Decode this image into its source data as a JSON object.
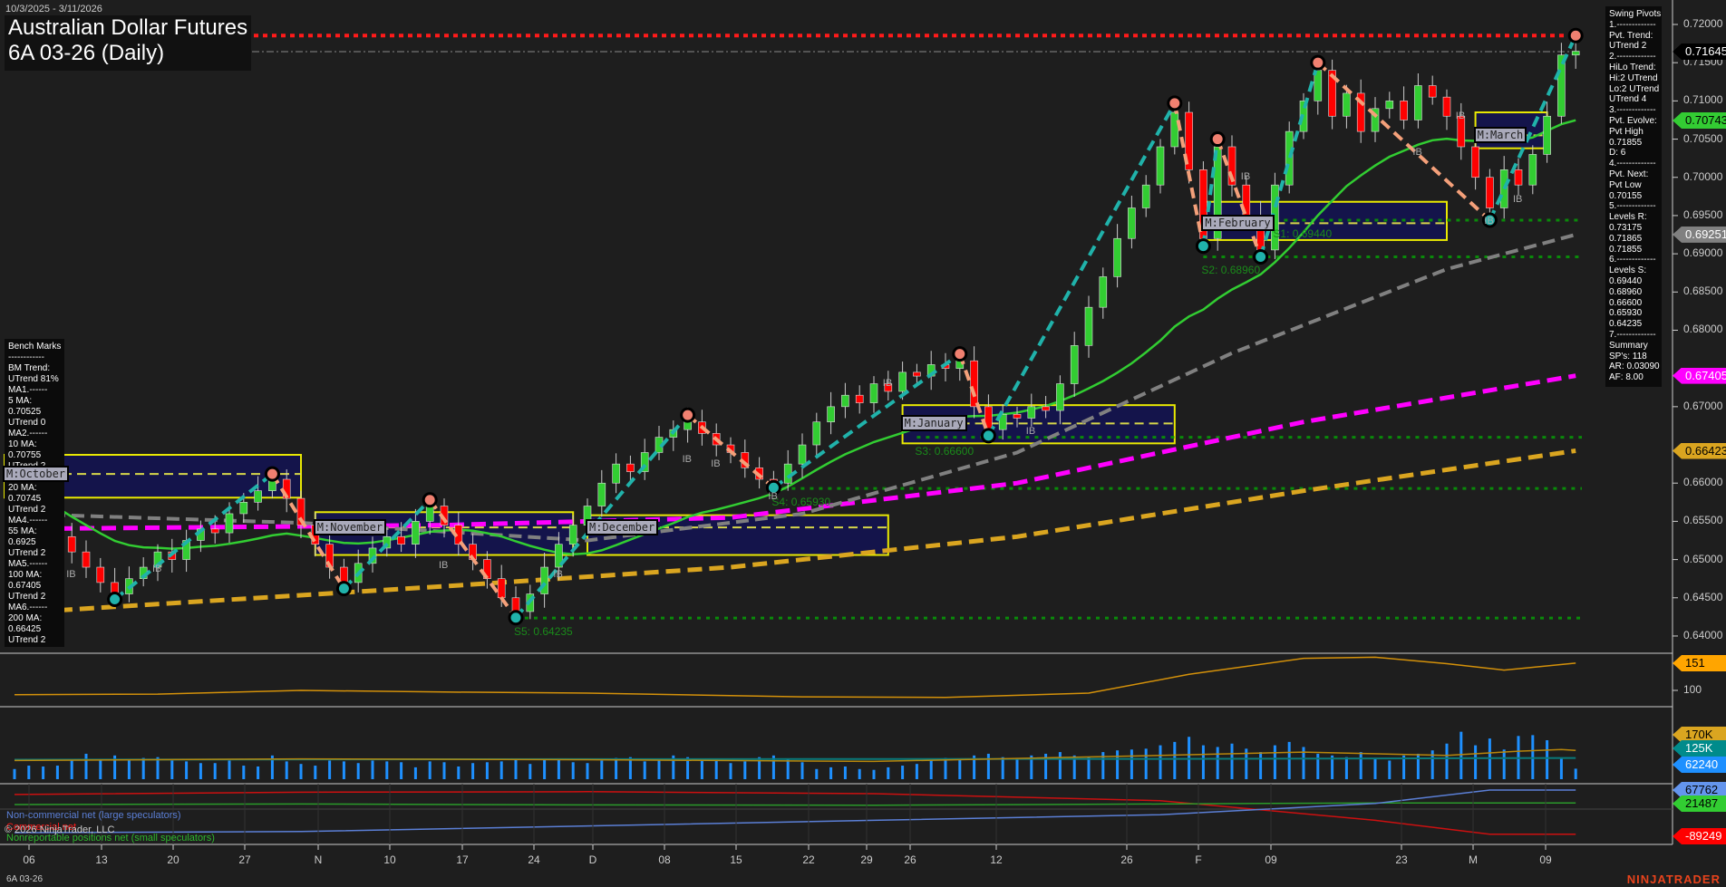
{
  "header": {
    "date_range": "10/3/2025 - 3/11/2026",
    "title": "Australian Dollar Futures",
    "subtitle": "6A 03-26 (Daily)"
  },
  "bench_marks": [
    "Bench Marks",
    "------------",
    "BM Trend:",
    "UTrend 81%",
    "MA1.------",
    "5 MA:",
    "0.70525",
    "UTrend 0",
    "MA2.------",
    "10 MA:",
    "0.70755",
    "UTrend 2",
    "MA3.------",
    "20 MA:",
    "0.70745",
    "UTrend 2",
    "MA4.------",
    "55 MA:",
    "0.6925",
    "UTrend 2",
    "MA5.------",
    "100 MA:",
    "0.67405",
    "UTrend 2",
    "MA6.------",
    "200 MA:",
    "0.66425",
    "UTrend 2"
  ],
  "swing_pivots": [
    "Swing Pivots",
    "1.-------------",
    "Pvt. Trend:",
    "UTrend 2",
    "2.-------------",
    "HiLo Trend:",
    "Hi:2 UTrend",
    "Lo:2 UTrend",
    "UTrend 4",
    "3.-------------",
    "Pvt. Evolve:",
    "Pvt High",
    "0.71855",
    "D: 6",
    "4.-------------",
    "Pvt. Next:",
    "Pvt Low",
    "0.70155",
    "5.-------------",
    "Levels R:",
    "0.73175",
    "0.71865",
    "0.71855",
    "6.-------------",
    "Levels S:",
    "0.69440",
    "0.68960",
    "0.66600",
    "0.65930",
    "0.64235",
    "7.-------------",
    "Summary",
    "SP's: 118",
    "AR: 0.03090",
    "AF: 8.00"
  ],
  "price_axis": [
    "0.72000",
    "0.71500",
    "0.71000",
    "0.70500",
    "0.70000",
    "0.69500",
    "0.69000",
    "0.68500",
    "0.68000",
    "0.67000",
    "0.66000",
    "0.65500",
    "0.65000",
    "0.64500",
    "0.64000"
  ],
  "price_tags": [
    {
      "label": "0.71645",
      "value": 0.71645,
      "bg": "#000000",
      "fg": "#ffffff"
    },
    {
      "label": "0.70743",
      "value": 0.70743,
      "bg": "#33cc33",
      "fg": "#000000"
    },
    {
      "label": "0.69251",
      "value": 0.69251,
      "bg": "#808080",
      "fg": "#ffffff"
    },
    {
      "label": "0.67405",
      "value": 0.67405,
      "bg": "#ff00ff",
      "fg": "#ffffff"
    },
    {
      "label": "0.66423",
      "value": 0.66423,
      "bg": "#daa520",
      "fg": "#000000"
    }
  ],
  "sub_tags": [
    {
      "label": "151",
      "bg": "#ffa500",
      "fg": "#000000"
    },
    {
      "label": "170K",
      "bg": "#daa520",
      "fg": "#000000"
    },
    {
      "label": "125K",
      "bg": "#008b8b",
      "fg": "#ffffff"
    },
    {
      "label": "62240",
      "bg": "#1e90ff",
      "fg": "#ffffff"
    },
    {
      "label": "67762",
      "bg": "#6495ed",
      "fg": "#000000"
    },
    {
      "label": "21487",
      "bg": "#32cd32",
      "fg": "#000000"
    },
    {
      "label": "-89249",
      "bg": "#ff0000",
      "fg": "#ffffff"
    }
  ],
  "sub_axis": {
    "osc_tick": "100"
  },
  "x_axis": [
    "06",
    "13",
    "20",
    "27",
    "N",
    "10",
    "17",
    "24",
    "D",
    "08",
    "15",
    "22",
    "29",
    "26",
    "12",
    "26",
    "F",
    "09",
    "23",
    "M",
    "09"
  ],
  "month_boxes": [
    {
      "label": "M:October",
      "from": -1,
      "to": 20,
      "top": 0.6637,
      "bottom": 0.6581,
      "mid": 0.6612
    },
    {
      "label": "M:November",
      "from": 21,
      "to": 39,
      "top": 0.6562,
      "bottom": 0.6506,
      "mid": 0.6542
    },
    {
      "label": "M:December",
      "from": 40,
      "to": 61,
      "top": 0.6558,
      "bottom": 0.6506,
      "mid": 0.6542
    },
    {
      "label": "M:January",
      "from": 62,
      "to": 81,
      "top": 0.6702,
      "bottom": 0.6652,
      "mid": 0.6678
    },
    {
      "label": "M:February",
      "from": 83,
      "to": 100,
      "top": 0.6968,
      "bottom": 0.6918,
      "mid": 0.694
    },
    {
      "label": "M:March",
      "from": 102,
      "to": 107,
      "top": 0.7085,
      "bottom": 0.7038,
      "mid": 0.7055
    }
  ],
  "levels": [
    {
      "label": "S1: 0.69440",
      "value": 0.6944,
      "from": 88
    },
    {
      "label": "S2: 0.68960",
      "value": 0.6896,
      "from": 83
    },
    {
      "label": "S3: 0.66600",
      "value": 0.666,
      "from": 63
    },
    {
      "label": "S4: 0.65930",
      "value": 0.6593,
      "from": 53
    },
    {
      "label": "S5: 0.64235",
      "value": 0.64235,
      "from": 35
    }
  ],
  "resistance_line": 0.71855,
  "last_price_line": 0.71645,
  "ib_labels": [
    [
      4,
      0.6488
    ],
    [
      10,
      0.6495
    ],
    [
      30,
      0.6499
    ],
    [
      38,
      0.6488
    ],
    [
      47,
      0.6638
    ],
    [
      49,
      0.6632
    ],
    [
      53,
      0.659
    ],
    [
      61,
      0.6738
    ],
    [
      71,
      0.6675
    ],
    [
      86,
      0.7008
    ],
    [
      98,
      0.704
    ],
    [
      101,
      0.7087
    ],
    [
      105,
      0.6978
    ],
    [
      103,
      0.695
    ]
  ],
  "legend": {
    "noncommercial": "Non-commercial net (large speculators)",
    "commercial": "Commercial net",
    "nonreportable": "Nonreportable positions net (small speculators)",
    "copyright": "© 2026 NinjaTrader, LLC"
  },
  "footer": {
    "instrument": "6A 03-26",
    "logo": "NINJATRADER"
  },
  "colors": {
    "up": "#32cd32",
    "down": "#ff0000",
    "ma20": "#32cd32",
    "ma55": "#808080",
    "ma100": "#ff00ff",
    "ma200": "#daa520",
    "swing_up": "#20b2aa",
    "swing_down": "#f4a07a"
  },
  "chart_data": {
    "type": "candlestick",
    "title": "Australian Dollar Futures 6A 03-26 (Daily)",
    "ylim": [
      0.6375,
      0.7225
    ],
    "closes": [
      0.66,
      0.658,
      0.656,
      0.653,
      0.651,
      0.649,
      0.647,
      0.6455,
      0.6475,
      0.649,
      0.651,
      0.65,
      0.6525,
      0.654,
      0.6535,
      0.656,
      0.6575,
      0.659,
      0.6605,
      0.658,
      0.6545,
      0.652,
      0.649,
      0.647,
      0.6495,
      0.6515,
      0.653,
      0.652,
      0.655,
      0.657,
      0.6545,
      0.652,
      0.65,
      0.6475,
      0.645,
      0.6432,
      0.6455,
      0.649,
      0.652,
      0.6545,
      0.657,
      0.66,
      0.6625,
      0.6615,
      0.664,
      0.666,
      0.667,
      0.668,
      0.6665,
      0.665,
      0.664,
      0.662,
      0.6605,
      0.66,
      0.6625,
      0.665,
      0.668,
      0.67,
      0.6715,
      0.6705,
      0.673,
      0.672,
      0.6745,
      0.674,
      0.6755,
      0.675,
      0.676,
      0.67,
      0.667,
      0.669,
      0.6685,
      0.67,
      0.6695,
      0.673,
      0.678,
      0.683,
      0.687,
      0.692,
      0.696,
      0.699,
      0.704,
      0.7085,
      0.701,
      0.692,
      0.704,
      0.699,
      0.695,
      0.6905,
      0.699,
      0.706,
      0.71,
      0.714,
      0.708,
      0.711,
      0.706,
      0.709,
      0.71,
      0.7075,
      0.712,
      0.7105,
      0.708,
      0.704,
      0.7,
      0.696,
      0.701,
      0.699,
      0.703,
      0.708,
      0.716,
      0.7165
    ],
    "pivots": [
      [
        7,
        0.6448,
        "L"
      ],
      [
        18,
        0.6612,
        "H"
      ],
      [
        23,
        0.6462,
        "L"
      ],
      [
        29,
        0.6578,
        "H"
      ],
      [
        35,
        0.6424,
        "L"
      ],
      [
        47,
        0.6689,
        "H"
      ],
      [
        53,
        0.6594,
        "L"
      ],
      [
        66,
        0.6769,
        "H"
      ],
      [
        68,
        0.6662,
        "L"
      ],
      [
        81,
        0.7097,
        "H"
      ],
      [
        83,
        0.691,
        "L"
      ],
      [
        84,
        0.705,
        "H"
      ],
      [
        87,
        0.6896,
        "L"
      ],
      [
        91,
        0.715,
        "H"
      ],
      [
        103,
        0.6944,
        "L"
      ],
      [
        109,
        0.71855,
        "H"
      ]
    ],
    "ma55": [
      [
        0,
        0.656
      ],
      [
        20,
        0.6548
      ],
      [
        40,
        0.6525
      ],
      [
        55,
        0.656
      ],
      [
        70,
        0.664
      ],
      [
        85,
        0.677
      ],
      [
        100,
        0.688
      ],
      [
        109,
        0.6925
      ]
    ],
    "ma100": [
      [
        0,
        0.654
      ],
      [
        30,
        0.6545
      ],
      [
        50,
        0.6555
      ],
      [
        70,
        0.66
      ],
      [
        90,
        0.668
      ],
      [
        109,
        0.67405
      ]
    ],
    "ma200": [
      [
        0,
        0.643
      ],
      [
        30,
        0.6465
      ],
      [
        50,
        0.649
      ],
      [
        70,
        0.653
      ],
      [
        90,
        0.659
      ],
      [
        109,
        0.66423
      ]
    ],
    "oscillator": [
      [
        0,
        92
      ],
      [
        10,
        93
      ],
      [
        20,
        100
      ],
      [
        30,
        97
      ],
      [
        40,
        95
      ],
      [
        55,
        88
      ],
      [
        65,
        87
      ],
      [
        75,
        95
      ],
      [
        82,
        130
      ],
      [
        90,
        160
      ],
      [
        95,
        162
      ],
      [
        100,
        150
      ],
      [
        104,
        138
      ],
      [
        109,
        151
      ]
    ],
    "volume": [
      60,
      80,
      75,
      80,
      110,
      150,
      115,
      140,
      110,
      125,
      130,
      110,
      105,
      95,
      95,
      110,
      80,
      75,
      140,
      105,
      90,
      80,
      110,
      105,
      95,
      110,
      105,
      100,
      70,
      105,
      100,
      75,
      95,
      100,
      105,
      115,
      90,
      115,
      120,
      100,
      95,
      110,
      125,
      130,
      105,
      120,
      140,
      130,
      110,
      120,
      95,
      105,
      130,
      140,
      120,
      100,
      60,
      70,
      75,
      60,
      55,
      70,
      80,
      90,
      110,
      125,
      120,
      140,
      150,
      130,
      120,
      140,
      150,
      160,
      140,
      130,
      160,
      170,
      175,
      180,
      200,
      220,
      250,
      200,
      190,
      210,
      180,
      160,
      200,
      220,
      190,
      150,
      140,
      130,
      160,
      125,
      110,
      140,
      150,
      170,
      210,
      280,
      200,
      240,
      175,
      255,
      260,
      230,
      120,
      62
    ],
    "volume_avg": [
      [
        0,
        110
      ],
      [
        20,
        120
      ],
      [
        40,
        115
      ],
      [
        60,
        105
      ],
      [
        80,
        140
      ],
      [
        90,
        160
      ],
      [
        100,
        140
      ],
      [
        105,
        165
      ],
      [
        108,
        175
      ],
      [
        109,
        170
      ]
    ],
    "volume_avg2": [
      [
        0,
        115
      ],
      [
        40,
        118
      ],
      [
        80,
        120
      ],
      [
        109,
        125
      ]
    ],
    "cot_noncommercial": [
      [
        0,
        -84000
      ],
      [
        20,
        -80000
      ],
      [
        40,
        -60000
      ],
      [
        60,
        -40000
      ],
      [
        80,
        -20000
      ],
      [
        95,
        20000
      ],
      [
        103,
        67762
      ],
      [
        109,
        67762
      ]
    ],
    "cot_commercial": [
      [
        0,
        52000
      ],
      [
        20,
        60000
      ],
      [
        40,
        62000
      ],
      [
        60,
        55000
      ],
      [
        80,
        30000
      ],
      [
        95,
        -40000
      ],
      [
        103,
        -89249
      ],
      [
        109,
        -89249
      ]
    ],
    "cot_nonreportable": [
      [
        0,
        16000
      ],
      [
        20,
        18000
      ],
      [
        40,
        15000
      ],
      [
        60,
        14000
      ],
      [
        80,
        18000
      ],
      [
        95,
        22000
      ],
      [
        109,
        21487
      ]
    ]
  }
}
